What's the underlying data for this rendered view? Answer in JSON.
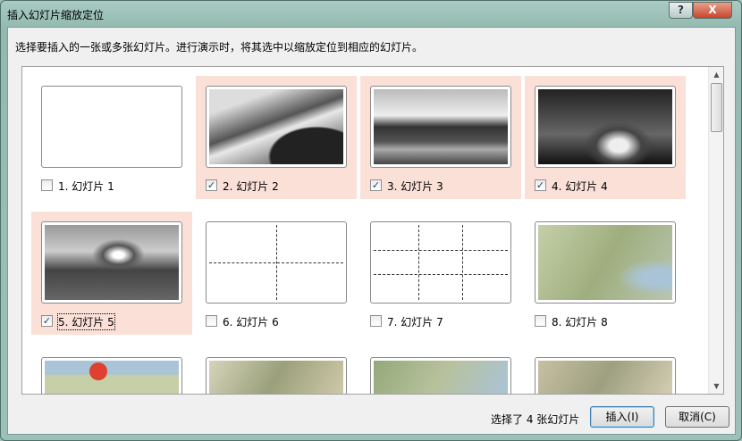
{
  "window": {
    "title": "插入幻灯片缩放定位",
    "help_label": "?",
    "close_label": "X"
  },
  "instruction": "选择要插入的一张或多张幻灯片。进行演示时，将其选中以缩放定位到相应的幻灯片。",
  "slides": [
    {
      "label": "1. 幻灯片 1",
      "checked": false
    },
    {
      "label": "2. 幻灯片 2",
      "checked": true
    },
    {
      "label": "3. 幻灯片 3",
      "checked": true
    },
    {
      "label": "4. 幻灯片 4",
      "checked": true
    },
    {
      "label": "5. 幻灯片 5",
      "checked": true
    },
    {
      "label": "6. 幻灯片 6",
      "checked": false
    },
    {
      "label": "7. 幻灯片 7",
      "checked": false
    },
    {
      "label": "8. 幻灯片 8",
      "checked": false
    }
  ],
  "check_mark": "✓",
  "footer": {
    "status": "选择了 4 张幻灯片",
    "insert_label": "插入(I)",
    "cancel_label": "取消(C)"
  },
  "colors": {
    "selected_bg": "#fbe0d8"
  }
}
